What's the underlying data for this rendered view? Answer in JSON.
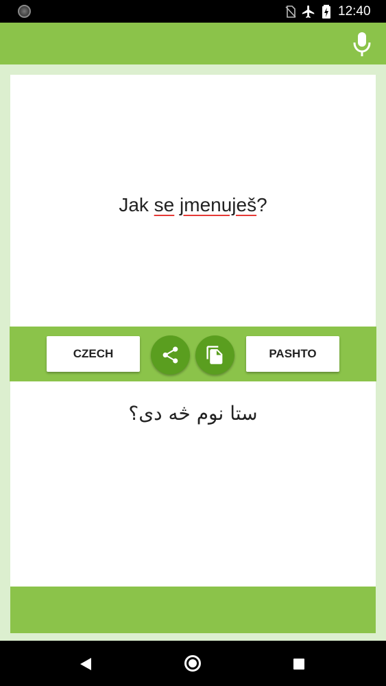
{
  "status_bar": {
    "time": "12:40",
    "icons": [
      "camera-notification-icon",
      "no-sim-icon",
      "airplane-mode-icon",
      "battery-charging-icon"
    ]
  },
  "app_bar": {
    "mic_icon": "microphone-icon"
  },
  "input": {
    "text_parts": [
      "Jak ",
      "se",
      " ",
      "jmenuješ",
      "?"
    ]
  },
  "toolbar": {
    "source_language": "CZECH",
    "target_language": "PASHTO",
    "share_icon": "share-icon",
    "copy_icon": "copy-icon"
  },
  "output": {
    "text": "ستا نوم څه دی؟"
  },
  "nav_bar": {
    "icons": [
      "back-icon",
      "home-icon",
      "recents-icon"
    ]
  },
  "colors": {
    "primary": "#8bc34a",
    "primary_dark": "#5a9e1f",
    "background": "#dcefcf",
    "spellcheck_underline": "#e53935"
  }
}
